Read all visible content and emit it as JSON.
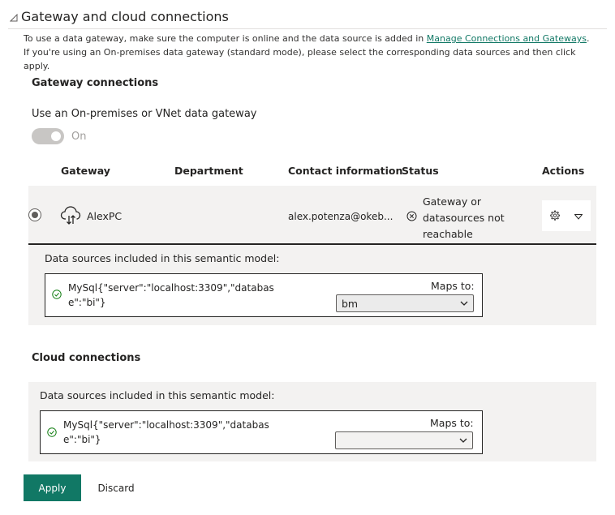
{
  "section": {
    "title": "Gateway and cloud connections",
    "description_before": "To use a data gateway, make sure the computer is online and the data source is added in ",
    "description_link": "Manage Connections and Gateways",
    "description_after": ". If you're using an On-premises data gateway (standard mode), please select the corresponding data sources and then click apply."
  },
  "gateway_connections": {
    "title": "Gateway connections",
    "toggle_label": "Use an On-premises or VNet data gateway",
    "toggle_state": "On",
    "columns": [
      "Gateway",
      "Department",
      "Contact information",
      "Status",
      "Actions"
    ],
    "row": {
      "gateway": "AlexPC",
      "department": "",
      "contact": "alex.potenza@okeb...",
      "status": "Gateway or datasources not reachable"
    },
    "panel": {
      "label": "Data sources included in this semantic model:",
      "datasource": "MySql{\"server\":\"localhost:3309\",\"database\":\"bi\"}",
      "maps_to_label": "Maps to:",
      "maps_to_value": "bm"
    }
  },
  "cloud_connections": {
    "title": "Cloud connections",
    "panel": {
      "label": "Data sources included in this semantic model:",
      "datasource": "MySql{\"server\":\"localhost:3309\",\"database\":\"bi\"}",
      "maps_to_label": "Maps to:",
      "maps_to_value": ""
    }
  },
  "buttons": {
    "apply": "Apply",
    "discard": "Discard"
  },
  "colors": {
    "accent": "#117865",
    "panel_bg": "#f3f2f1",
    "success": "#107c10"
  },
  "icons": [
    "collapse-icon",
    "cloud-gateway-icon",
    "error-circle-icon",
    "gear-icon",
    "expand-chevron-icon",
    "check-circle-icon",
    "chevron-down-icon"
  ]
}
